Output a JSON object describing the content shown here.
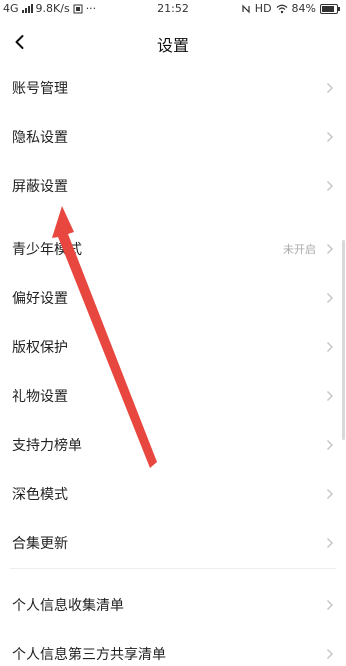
{
  "statusbar": {
    "network": "4G",
    "speed": "9.8K/s",
    "time": "21:52",
    "hd": "HD",
    "battery": "84%",
    "battery_level": 0.84
  },
  "header": {
    "title": "设置",
    "back_icon": "chevron-left-icon"
  },
  "settings": {
    "items": [
      {
        "label": "账号管理"
      },
      {
        "label": "隐私设置"
      },
      {
        "label": "屏蔽设置"
      },
      {
        "label": "青少年模式",
        "value": "未开启"
      },
      {
        "label": "偏好设置"
      },
      {
        "label": "版权保护"
      },
      {
        "label": "礼物设置"
      },
      {
        "label": "支持力榜单"
      },
      {
        "label": "深色模式"
      },
      {
        "label": "合集更新"
      }
    ],
    "info_items": [
      {
        "label": "个人信息收集清单"
      },
      {
        "label": "个人信息第三方共享清单"
      }
    ]
  },
  "colors": {
    "annotation_arrow": "#e8473f",
    "chevron": "#c4c4c4",
    "value_text": "#aaaaaa"
  }
}
